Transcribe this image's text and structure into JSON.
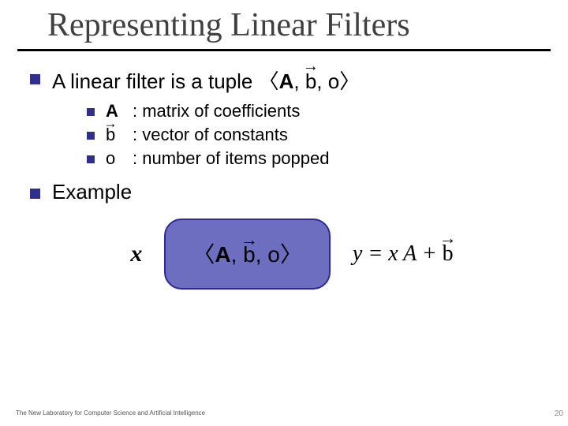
{
  "title": "Representing Linear Filters",
  "main": {
    "line1_prefix": "A linear filter is a tuple ",
    "tuple_open": "〈",
    "tuple_A": "A",
    "tuple_sep1": ", ",
    "tuple_b": "b",
    "tuple_sep2": ", o",
    "tuple_close": "〉",
    "defs": {
      "A_term": "A",
      "A_desc": ":  matrix of coefficients",
      "b_term": "b",
      "b_desc": ":  vector of constants",
      "o_term": "o",
      "o_desc": ":  number of items popped"
    },
    "example_label": "Example"
  },
  "diagram": {
    "x": "x",
    "box_open": "〈",
    "box_A": "A",
    "box_sep1": ", ",
    "box_b": "b",
    "box_sep2": ", o",
    "box_close": "〉",
    "y_prefix": "y = x A + ",
    "y_bvec": "b"
  },
  "footer": "The New Laboratory for Computer Science and Artificial Intelligence",
  "page": "20"
}
